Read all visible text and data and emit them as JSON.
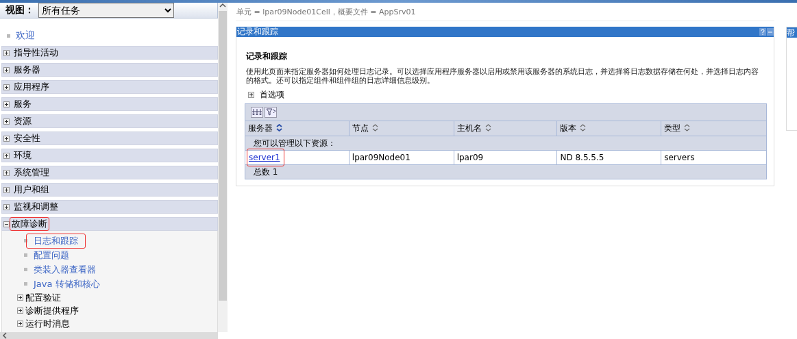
{
  "view": {
    "label": "视图：",
    "value": "所有任务"
  },
  "nav": {
    "welcome": "欢迎",
    "categories": [
      {
        "label": "指导性活动",
        "expanded": false,
        "highlighted": false
      },
      {
        "label": "服务器",
        "expanded": false,
        "highlighted": false
      },
      {
        "label": "应用程序",
        "expanded": false,
        "highlighted": false
      },
      {
        "label": "服务",
        "expanded": false,
        "highlighted": false
      },
      {
        "label": "资源",
        "expanded": false,
        "highlighted": false
      },
      {
        "label": "安全性",
        "expanded": false,
        "highlighted": false
      },
      {
        "label": "环境",
        "expanded": false,
        "highlighted": false
      },
      {
        "label": "系统管理",
        "expanded": false,
        "highlighted": false
      },
      {
        "label": "用户和组",
        "expanded": false,
        "highlighted": false
      },
      {
        "label": "监视和调整",
        "expanded": false,
        "highlighted": false
      },
      {
        "label": "故障诊断",
        "expanded": true,
        "highlighted": true,
        "children": [
          {
            "label": "日志和跟踪",
            "kind": "link",
            "highlighted": true
          },
          {
            "label": "配置问题",
            "kind": "link",
            "highlighted": false
          },
          {
            "label": "类装入器查看器",
            "kind": "link",
            "highlighted": false
          },
          {
            "label": "Java 转储和核心",
            "kind": "link",
            "highlighted": false
          },
          {
            "label": "配置验证",
            "kind": "group",
            "highlighted": false
          },
          {
            "label": "诊断提供程序",
            "kind": "group",
            "highlighted": false
          },
          {
            "label": "运行时消息",
            "kind": "group",
            "highlighted": false
          }
        ]
      }
    ]
  },
  "breadcrumb": "单元 = lpar09Node01Cell，概要文件 = AppSrv01",
  "panel": {
    "title": "记录和跟踪",
    "heading": "记录和跟踪",
    "description": "使用此页面来指定服务器如何处理日志记录。可以选择应用程序服务器以启用或禁用该服务器的系统日志，并选择将日志数据存储在何处，并选择日志内容的格式。还可以指定组件和组件组的日志详细信息级别。",
    "preferences": {
      "label": "首选项",
      "expanded": false
    },
    "table": {
      "columns": [
        {
          "label": "服务器",
          "sorted": true
        },
        {
          "label": "节点",
          "sorted": false
        },
        {
          "label": "主机名",
          "sorted": false
        },
        {
          "label": "版本",
          "sorted": false
        },
        {
          "label": "类型",
          "sorted": false
        }
      ],
      "message": "您可以管理以下资源：",
      "rows": [
        {
          "cells": [
            "server1",
            "lpar09Node01",
            "lpar09",
            "ND 8.5.5.5",
            "servers"
          ],
          "highlighted": true
        }
      ],
      "total": "总数 1"
    }
  },
  "help": {
    "title": "帮"
  }
}
